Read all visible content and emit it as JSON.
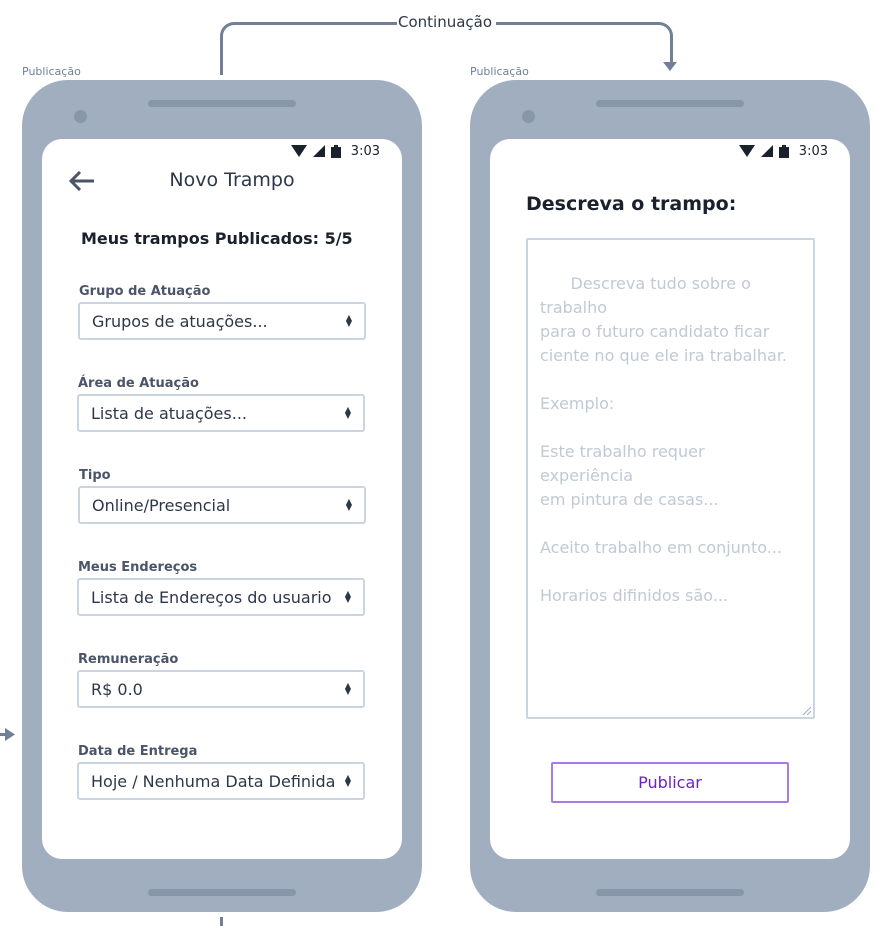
{
  "connector": {
    "label": "Continuação"
  },
  "frames": [
    {
      "label": "Publicação"
    },
    {
      "label": "Publicação"
    }
  ],
  "status_bar": {
    "time": "3:03",
    "icons": [
      "wifi-icon",
      "signal-icon",
      "battery-icon"
    ]
  },
  "screen1": {
    "title": "Novo Trampo",
    "back_icon": "arrow-left-icon",
    "counter": "Meus trampos Publicados: 5/5",
    "fields": [
      {
        "label": "Grupo de Atuação",
        "value": "Grupos de atuações..."
      },
      {
        "label": "Área de Atuação",
        "value": "Lista de atuações..."
      },
      {
        "label": "Tipo",
        "value": "Online/Presencial"
      },
      {
        "label": "Meus Endereços",
        "value": "Lista de Endereços do usuario"
      },
      {
        "label": "Remuneração",
        "value": "R$ 0.0"
      },
      {
        "label": "Data de Entrega",
        "value": "Hoje / Nenhuma Data Definida"
      }
    ]
  },
  "screen2": {
    "title": "Descreva o trampo:",
    "textarea_placeholder": "Descreva tudo sobre o trabalho\npara o futuro candidato ficar\nciente no que ele ira trabalhar.\n\nExemplo:\n\nEste trabalho requer experiência\nem pintura de casas...\n\nAceito trabalho em conjunto...\n\nHorarios difinidos são...",
    "publish_label": "Publicar"
  },
  "colors": {
    "phone_body": "#a0aec0",
    "connector": "#718096",
    "accent": "#6b21c8",
    "accent_border": "#a779e9"
  }
}
